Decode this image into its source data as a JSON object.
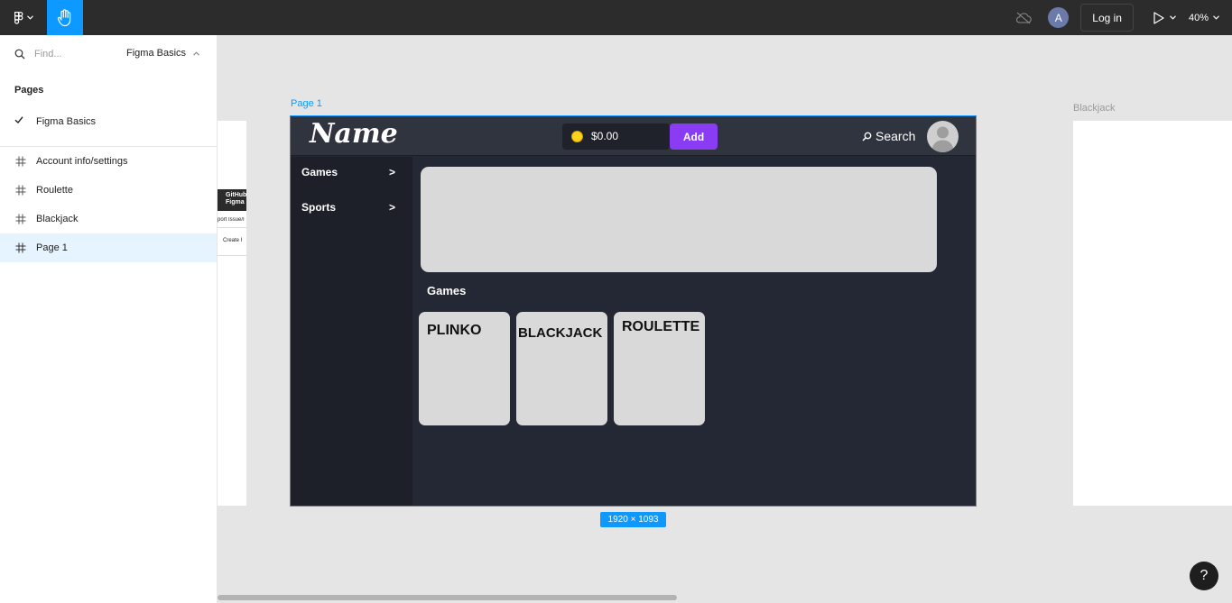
{
  "toolbar": {
    "logo_icon": "figma-logo-icon",
    "hand_tool_icon": "hand-icon",
    "offline_icon": "cloud-off-icon",
    "avatar_initial": "A",
    "login_label": "Log in",
    "present_icon": "play-icon",
    "zoom_label": "40%"
  },
  "sidebar": {
    "search_placeholder": "Find...",
    "file_name": "Figma Basics",
    "pages_heading": "Pages",
    "pages": [
      {
        "label": "Figma Basics",
        "checked": true
      }
    ],
    "layers": [
      {
        "label": "Account info/settings"
      },
      {
        "label": "Roulette"
      },
      {
        "label": "Blackjack"
      },
      {
        "label": "Page 1",
        "selected": true
      }
    ]
  },
  "canvas": {
    "left_frame": {
      "dark_text_1": "GitHub",
      "dark_text_2": "Figma",
      "line_1": "port Issue/I",
      "line_2": "Create I"
    },
    "frame_label_main": "Page 1",
    "frame_label_right": "Blackjack",
    "frame_dims": "1920 × 1093",
    "accent_color": "#0d99ff"
  },
  "design": {
    "brand": "Name",
    "balance": "$0.00",
    "add_label": "Add",
    "search_label": "Search",
    "nav": [
      {
        "label": "Games",
        "arrow": ">"
      },
      {
        "label": "Sports",
        "arrow": ">"
      }
    ],
    "games_heading": "Games",
    "cards": [
      {
        "label": "PLINKO"
      },
      {
        "label": "BLACKJACK"
      },
      {
        "label": "ROULETTE"
      }
    ],
    "add_color": "#8a3cf5"
  },
  "help_label": "?"
}
